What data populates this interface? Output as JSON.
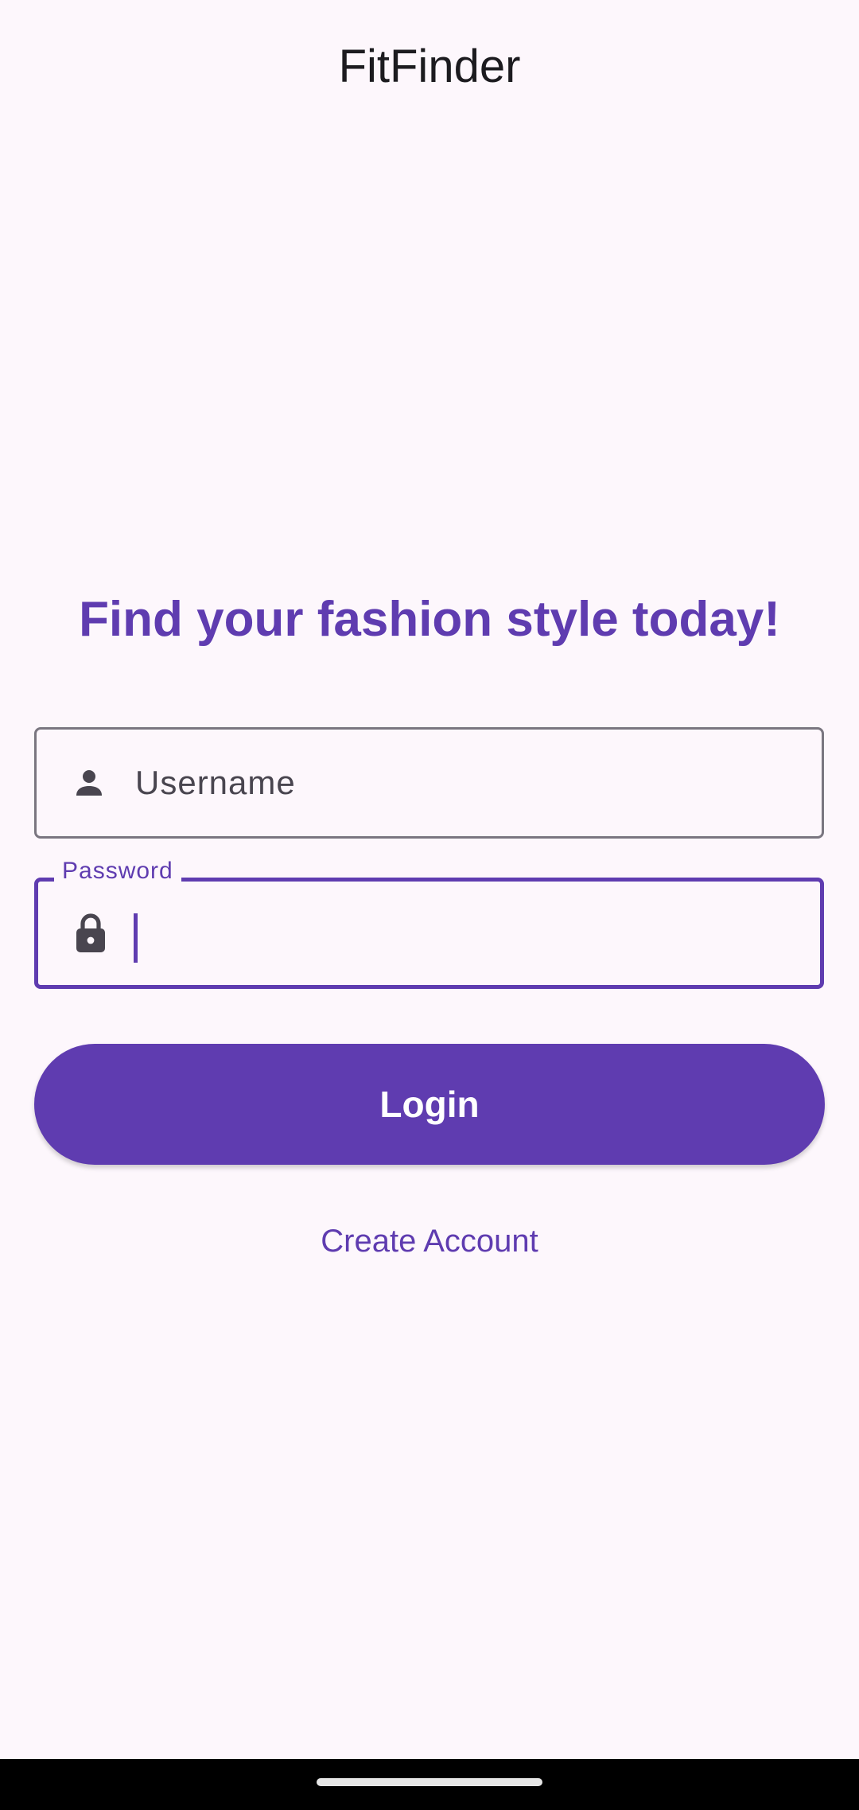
{
  "app": {
    "title": "FitFinder"
  },
  "main": {
    "headline": "Find your fashion style today!"
  },
  "form": {
    "username": {
      "placeholder": "Username",
      "value": "",
      "icon": "person-icon"
    },
    "password": {
      "label": "Password",
      "value": "",
      "icon": "lock-icon",
      "focused": true
    },
    "login_label": "Login",
    "create_account_label": "Create Account"
  },
  "colors": {
    "accent": "#5f3cb0",
    "background": "#fdf7fc",
    "text_primary": "#1c1b1f",
    "field_border": "#7a7680",
    "icon": "#49454f"
  }
}
